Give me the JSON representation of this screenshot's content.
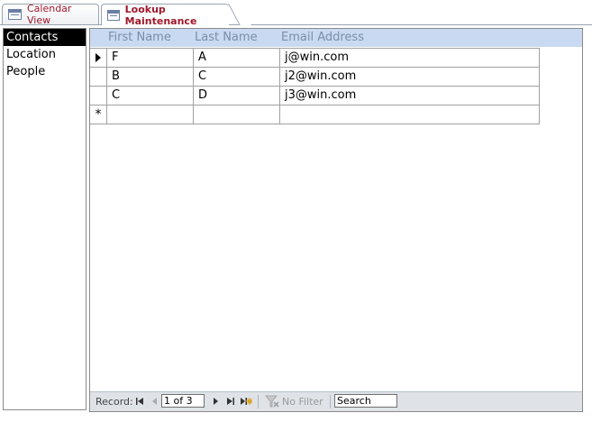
{
  "tabs": [
    {
      "label": "Calendar View",
      "icon": "form-icon",
      "active": false
    },
    {
      "label": "Lookup Maintenance",
      "icon": "form-icon",
      "active": true
    }
  ],
  "nav_list": {
    "items": [
      "Contacts",
      "Location",
      "People"
    ],
    "selected": "Contacts"
  },
  "datasheet": {
    "columns": [
      "First Name",
      "Last Name",
      "Email Address"
    ],
    "rows": [
      {
        "first": "F",
        "last": "A",
        "email": "j@win.com"
      },
      {
        "first": "B",
        "last": "C",
        "email": "j2@win.com"
      },
      {
        "first": "C",
        "last": "D",
        "email": "j3@win.com"
      }
    ],
    "new_row_marker": "*"
  },
  "navbar": {
    "record_label": "Record:",
    "record_value": "1 of 3",
    "filter_label": "No Filter",
    "search_label": "Search"
  },
  "colors": {
    "tab_text": "#a0172b",
    "header_bg": "#c9d9f1",
    "header_text": "#7b8ea8",
    "selected_item_bg": "#000000"
  }
}
